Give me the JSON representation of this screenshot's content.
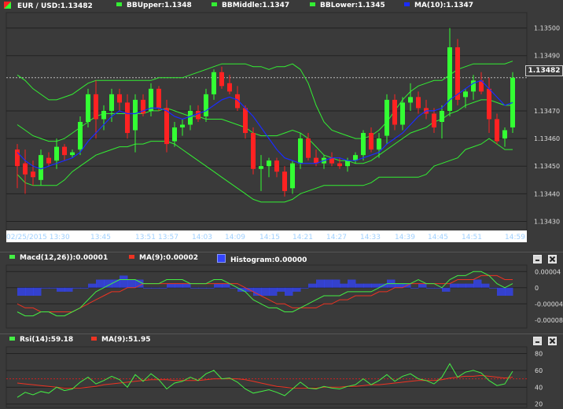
{
  "colors": {
    "background": "#3a3a3a",
    "grid": "#222222",
    "bull": "#33ff33",
    "bear": "#ff2222",
    "bb": "#33ee33",
    "ma": "#1a2cff",
    "macd_line": "#44ee44",
    "macd_signal": "#ee3322",
    "histogram": "#3344ff",
    "rsi": "#44ee44",
    "rsi_ma": "#ee3322",
    "axis_text": "#dddddd",
    "time_text": "#9fd0ff"
  },
  "price_panel": {
    "legend": [
      {
        "label": "EUR / USD:1.13482",
        "icon": "red-green-flag-icon"
      },
      {
        "label": "BBUpper:1.1348",
        "icon": "green-square-icon"
      },
      {
        "label": "BBMiddle:1.1347",
        "icon": "green-square-icon"
      },
      {
        "label": "BBLower:1.1345",
        "icon": "green-square-icon"
      },
      {
        "label": "MA(10):1.1347",
        "icon": "blue-square-icon"
      }
    ],
    "current_price": "1.13482",
    "y_ticks": [
      "1.13500",
      "1.13490",
      "1.13470",
      "1.13460",
      "1.13450",
      "1.13440",
      "1.13430"
    ],
    "x_ticks": [
      "02/25/2015 13:30",
      "13:45",
      "13:51",
      "13:57",
      "14:03",
      "14:09",
      "14:15",
      "14:21",
      "14:27",
      "14:33",
      "14:39",
      "14:45",
      "14:51",
      "14:59"
    ]
  },
  "macd_panel": {
    "legend": [
      {
        "label": "Macd(12,26)):0.00001",
        "icon": "green-square-icon"
      },
      {
        "label": "MA(9):0.00002",
        "icon": "red-square-icon"
      },
      {
        "label": "Histogram:0.00000",
        "icon": "blue-histogram-icon"
      }
    ],
    "y_ticks": [
      "0.00004",
      "0",
      "-0.00004",
      "-0.00008"
    ]
  },
  "rsi_panel": {
    "legend": [
      {
        "label": "Rsi(14):59.18",
        "icon": "green-square-icon"
      },
      {
        "label": "MA(9):51.95",
        "icon": "red-square-icon"
      }
    ],
    "y_ticks": [
      "80",
      "60",
      "40",
      "20"
    ]
  },
  "chart_data": [
    {
      "type": "candlestick",
      "title": "EUR / USD",
      "ylim": [
        1.13427,
        1.13505
      ],
      "x_count": 64,
      "candles": [
        [
          1.13456,
          1.13458,
          1.13442,
          1.1345
        ],
        [
          1.13451,
          1.13456,
          1.1344,
          1.13447
        ],
        [
          1.13448,
          1.13452,
          1.13443,
          1.13446
        ],
        [
          1.13445,
          1.13456,
          1.13443,
          1.13454
        ],
        [
          1.13453,
          1.13455,
          1.1345,
          1.13451
        ],
        [
          1.13452,
          1.1346,
          1.13449,
          1.13457
        ],
        [
          1.13457,
          1.13458,
          1.13452,
          1.13454
        ],
        [
          1.13454,
          1.13456,
          1.13453,
          1.13455
        ],
        [
          1.13456,
          1.13468,
          1.13454,
          1.13466
        ],
        [
          1.13466,
          1.13478,
          1.13464,
          1.13476
        ],
        [
          1.13476,
          1.13481,
          1.1346,
          1.13467
        ],
        [
          1.13467,
          1.13472,
          1.13463,
          1.1347
        ],
        [
          1.1347,
          1.13478,
          1.13466,
          1.13476
        ],
        [
          1.13476,
          1.13478,
          1.1347,
          1.13473
        ],
        [
          1.13473,
          1.13476,
          1.1346,
          1.13462
        ],
        [
          1.13463,
          1.13476,
          1.13455,
          1.13474
        ],
        [
          1.13474,
          1.13476,
          1.13468,
          1.13469
        ],
        [
          1.1347,
          1.1348,
          1.13468,
          1.13478
        ],
        [
          1.13478,
          1.13479,
          1.1347,
          1.13471
        ],
        [
          1.13471,
          1.13474,
          1.13455,
          1.13458
        ],
        [
          1.13459,
          1.13466,
          1.13457,
          1.13464
        ],
        [
          1.13464,
          1.13467,
          1.13461,
          1.13465
        ],
        [
          1.13465,
          1.13472,
          1.13463,
          1.1347
        ],
        [
          1.1347,
          1.13472,
          1.13466,
          1.13467
        ],
        [
          1.13468,
          1.13478,
          1.13466,
          1.13476
        ],
        [
          1.13476,
          1.13485,
          1.13474,
          1.13484
        ],
        [
          1.13484,
          1.13486,
          1.13478,
          1.13479
        ],
        [
          1.1348,
          1.13483,
          1.13476,
          1.13477
        ],
        [
          1.13476,
          1.13479,
          1.1347,
          1.13471
        ],
        [
          1.13471,
          1.13472,
          1.1346,
          1.13462
        ],
        [
          1.13462,
          1.13464,
          1.13447,
          1.13449
        ],
        [
          1.13449,
          1.13454,
          1.13441,
          1.1345
        ],
        [
          1.1345,
          1.13453,
          1.13446,
          1.13452
        ],
        [
          1.13452,
          1.13453,
          1.13446,
          1.13448
        ],
        [
          1.13448,
          1.1345,
          1.13439,
          1.13441
        ],
        [
          1.13442,
          1.13452,
          1.1344,
          1.13451
        ],
        [
          1.13451,
          1.13462,
          1.13449,
          1.1346
        ],
        [
          1.1346,
          1.13462,
          1.13452,
          1.13453
        ],
        [
          1.13453,
          1.13456,
          1.1345,
          1.13451
        ],
        [
          1.13451,
          1.13454,
          1.13449,
          1.13453
        ],
        [
          1.13453,
          1.13455,
          1.1345,
          1.13451
        ],
        [
          1.13451,
          1.13453,
          1.13449,
          1.1345
        ],
        [
          1.1345,
          1.13453,
          1.13448,
          1.13452
        ],
        [
          1.13452,
          1.13455,
          1.13451,
          1.13454
        ],
        [
          1.13454,
          1.13463,
          1.13452,
          1.13462
        ],
        [
          1.13462,
          1.13464,
          1.13455,
          1.13456
        ],
        [
          1.13456,
          1.13462,
          1.13453,
          1.1346
        ],
        [
          1.13461,
          1.13476,
          1.13458,
          1.13474
        ],
        [
          1.13474,
          1.13476,
          1.13463,
          1.13465
        ],
        [
          1.13465,
          1.13475,
          1.13463,
          1.13473
        ],
        [
          1.13473,
          1.1348,
          1.1347,
          1.13475
        ],
        [
          1.13475,
          1.13477,
          1.13469,
          1.13471
        ],
        [
          1.13471,
          1.13474,
          1.13467,
          1.13469
        ],
        [
          1.13469,
          1.13471,
          1.13462,
          1.13464
        ],
        [
          1.13466,
          1.13472,
          1.1346,
          1.1347
        ],
        [
          1.1347,
          1.135,
          1.13468,
          1.13493
        ],
        [
          1.13493,
          1.13496,
          1.13472,
          1.13474
        ],
        [
          1.13475,
          1.13478,
          1.13471,
          1.13477
        ],
        [
          1.13477,
          1.13483,
          1.13474,
          1.13481
        ],
        [
          1.13481,
          1.13484,
          1.13476,
          1.13477
        ],
        [
          1.13478,
          1.13482,
          1.13462,
          1.13467
        ],
        [
          1.13467,
          1.13469,
          1.13458,
          1.13459
        ],
        [
          1.1346,
          1.13464,
          1.13457,
          1.13463
        ],
        [
          1.13464,
          1.13484,
          1.13462,
          1.13482
        ]
      ],
      "ma": [
        1.13455,
        1.13452,
        1.1345,
        1.13449,
        1.1345,
        1.13451,
        1.13452,
        1.13453,
        1.13455,
        1.13459,
        1.13462,
        1.13465,
        1.13468,
        1.1347,
        1.13469,
        1.13469,
        1.1347,
        1.13471,
        1.13471,
        1.1347,
        1.13468,
        1.13467,
        1.13468,
        1.13469,
        1.1347,
        1.13472,
        1.13474,
        1.13475,
        1.13474,
        1.13471,
        1.13468,
        1.13464,
        1.1346,
        1.13456,
        1.13453,
        1.13452,
        1.13451,
        1.13451,
        1.13451,
        1.13452,
        1.13453,
        1.13453,
        1.13452,
        1.13452,
        1.13453,
        1.13454,
        1.13455,
        1.13458,
        1.1346,
        1.13462,
        1.13465,
        1.13468,
        1.1347,
        1.1347,
        1.13471,
        1.13474,
        1.13476,
        1.13478,
        1.1348,
        1.13481,
        1.13478,
        1.13475,
        1.13472,
        1.13473
      ],
      "bb_upper": [
        1.13483,
        1.13481,
        1.13478,
        1.13476,
        1.13474,
        1.13474,
        1.13475,
        1.13476,
        1.13478,
        1.1348,
        1.13481,
        1.13481,
        1.13481,
        1.13481,
        1.13481,
        1.13481,
        1.13481,
        1.13481,
        1.13482,
        1.13482,
        1.13482,
        1.13482,
        1.13483,
        1.13484,
        1.13485,
        1.13486,
        1.13487,
        1.13487,
        1.13487,
        1.13487,
        1.13486,
        1.13486,
        1.13485,
        1.13486,
        1.13486,
        1.13487,
        1.13485,
        1.1348,
        1.13472,
        1.13466,
        1.13463,
        1.13462,
        1.13461,
        1.1346,
        1.1346,
        1.13461,
        1.13463,
        1.13466,
        1.1347,
        1.13474,
        1.13477,
        1.13479,
        1.1348,
        1.13481,
        1.13481,
        1.13483,
        1.13485,
        1.13486,
        1.13487,
        1.13487,
        1.13487,
        1.13487,
        1.13487,
        1.13488
      ],
      "bb_lower": [
        1.13447,
        1.13444,
        1.13443,
        1.13443,
        1.13443,
        1.13443,
        1.13445,
        1.13448,
        1.1345,
        1.13452,
        1.13454,
        1.13455,
        1.13456,
        1.13457,
        1.13457,
        1.13458,
        1.13458,
        1.13459,
        1.13459,
        1.13459,
        1.13458,
        1.13456,
        1.13454,
        1.13452,
        1.1345,
        1.13448,
        1.13446,
        1.13444,
        1.13442,
        1.1344,
        1.13438,
        1.13437,
        1.13437,
        1.13437,
        1.13437,
        1.13438,
        1.1344,
        1.13441,
        1.13442,
        1.13443,
        1.13443,
        1.13443,
        1.13443,
        1.13443,
        1.13443,
        1.13444,
        1.13446,
        1.13446,
        1.13446,
        1.13446,
        1.13446,
        1.13446,
        1.13447,
        1.1345,
        1.13451,
        1.13452,
        1.13453,
        1.13456,
        1.13457,
        1.13458,
        1.1346,
        1.13458,
        1.13456,
        1.13456
      ],
      "bb_middle": [
        1.13465,
        1.13463,
        1.13461,
        1.1346,
        1.13459,
        1.13459,
        1.1346,
        1.13462,
        1.13464,
        1.13466,
        1.13468,
        1.13469,
        1.13469,
        1.13469,
        1.13469,
        1.13469,
        1.13469,
        1.1347,
        1.1347,
        1.13471,
        1.1347,
        1.13469,
        1.13468,
        1.13468,
        1.13467,
        1.13467,
        1.13467,
        1.13466,
        1.13465,
        1.13464,
        1.13462,
        1.13461,
        1.13461,
        1.13461,
        1.13462,
        1.13463,
        1.13462,
        1.1346,
        1.13457,
        1.13454,
        1.13453,
        1.13452,
        1.13452,
        1.13451,
        1.13451,
        1.13452,
        1.13454,
        1.13456,
        1.13458,
        1.1346,
        1.13462,
        1.13463,
        1.13464,
        1.13466,
        1.13467,
        1.13469,
        1.1347,
        1.13472,
        1.13473,
        1.13474,
        1.13474,
        1.13473,
        1.13472,
        1.13472
      ]
    },
    {
      "type": "line",
      "title": "Macd(12,26))",
      "ylim": [
        -0.0001,
        6e-05
      ],
      "macd": [
        -6e-05,
        -7e-05,
        -7e-05,
        -6e-05,
        -6e-05,
        -7e-05,
        -7e-05,
        -6e-05,
        -5e-05,
        -3e-05,
        -1e-05,
        0.0,
        1e-05,
        2e-05,
        2e-05,
        2e-05,
        1e-05,
        1e-05,
        1e-05,
        2e-05,
        2e-05,
        2e-05,
        1e-05,
        1e-05,
        1e-05,
        2e-05,
        2e-05,
        1e-05,
        0.0,
        -1e-05,
        -3e-05,
        -4e-05,
        -5e-05,
        -5e-05,
        -6e-05,
        -6e-05,
        -5e-05,
        -4e-05,
        -3e-05,
        -2e-05,
        -2e-05,
        -2e-05,
        -1e-05,
        -1e-05,
        -1e-05,
        -1e-05,
        0.0,
        1e-05,
        1e-05,
        1e-05,
        1e-05,
        2e-05,
        1e-05,
        1e-05,
        0.0,
        2e-05,
        3e-05,
        3e-05,
        4e-05,
        4e-05,
        3e-05,
        1e-05,
        0.0,
        1e-05
      ],
      "signal": [
        -4e-05,
        -5e-05,
        -5e-05,
        -6e-05,
        -6e-05,
        -6e-05,
        -6e-05,
        -6e-05,
        -5e-05,
        -4e-05,
        -3e-05,
        -2e-05,
        -1e-05,
        -1e-05,
        0.0,
        0.0,
        1e-05,
        1e-05,
        1e-05,
        1e-05,
        1e-05,
        1e-05,
        1e-05,
        1e-05,
        1e-05,
        1e-05,
        1e-05,
        1e-05,
        1e-05,
        0.0,
        -1e-05,
        -2e-05,
        -3e-05,
        -4e-05,
        -4e-05,
        -5e-05,
        -5e-05,
        -5e-05,
        -5e-05,
        -4e-05,
        -4e-05,
        -3e-05,
        -3e-05,
        -2e-05,
        -2e-05,
        -2e-05,
        -1e-05,
        -1e-05,
        0.0,
        0.0,
        1e-05,
        1e-05,
        1e-05,
        1e-05,
        1e-05,
        1e-05,
        2e-05,
        2e-05,
        2e-05,
        3e-05,
        3e-05,
        3e-05,
        2e-05,
        2e-05
      ],
      "histogram": [
        -2e-05,
        -2e-05,
        -2e-05,
        0.0,
        0.0,
        -1e-05,
        -1e-05,
        0.0,
        0.0,
        1e-05,
        2e-05,
        2e-05,
        2e-05,
        3e-05,
        2e-05,
        2e-05,
        0.0,
        0.0,
        0.0,
        1e-05,
        1e-05,
        1e-05,
        0.0,
        0.0,
        0.0,
        1e-05,
        1e-05,
        0.0,
        -1e-05,
        -1e-05,
        -2e-05,
        -2e-05,
        -2e-05,
        -1e-05,
        -2e-05,
        -1e-05,
        0.0,
        1e-05,
        2e-05,
        2e-05,
        2e-05,
        1e-05,
        2e-05,
        1e-05,
        1e-05,
        1e-05,
        1e-05,
        2e-05,
        1e-05,
        1e-05,
        0.0,
        1e-05,
        0.0,
        0.0,
        -1e-05,
        1e-05,
        1e-05,
        1e-05,
        2e-05,
        1e-05,
        0.0,
        -2e-05,
        -2e-05,
        -1e-05
      ]
    },
    {
      "type": "line",
      "title": "Rsi(14)",
      "ylim": [
        16,
        88
      ],
      "rsi": [
        28,
        34,
        31,
        35,
        33,
        40,
        36,
        38,
        46,
        52,
        44,
        48,
        53,
        49,
        40,
        55,
        47,
        56,
        49,
        38,
        45,
        47,
        52,
        48,
        56,
        60,
        50,
        51,
        46,
        38,
        33,
        35,
        37,
        34,
        30,
        38,
        46,
        39,
        38,
        41,
        39,
        38,
        41,
        43,
        50,
        43,
        48,
        55,
        47,
        53,
        56,
        50,
        48,
        44,
        52,
        68,
        52,
        58,
        60,
        57,
        48,
        42,
        44,
        59
      ],
      "ma": [
        45,
        44,
        43,
        42,
        41,
        40,
        39,
        39,
        39,
        40,
        41,
        43,
        44,
        45,
        46,
        47,
        48,
        49,
        49,
        49,
        48,
        48,
        48,
        48,
        49,
        50,
        50,
        50,
        50,
        49,
        47,
        45,
        43,
        41,
        40,
        39,
        39,
        39,
        39,
        40,
        40,
        40,
        41,
        41,
        42,
        43,
        43,
        44,
        45,
        46,
        47,
        48,
        48,
        48,
        49,
        51,
        52,
        53,
        53,
        54,
        53,
        52,
        51,
        52
      ]
    }
  ]
}
